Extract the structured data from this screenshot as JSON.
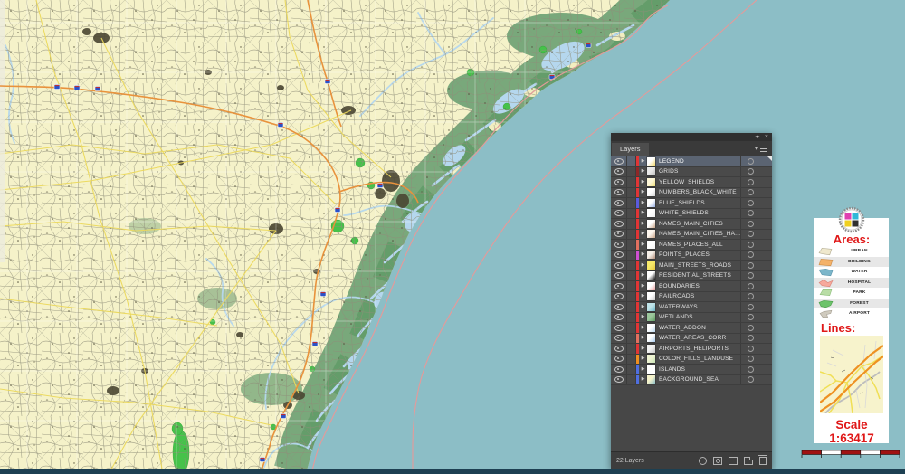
{
  "map": {
    "colors": {
      "sea": "#8cbec6",
      "land": "#f5f2c9",
      "marsh": "#79a87b",
      "water_channels": "#b5d7ee",
      "forest_bright": "#46c24a",
      "urban": "#4a4632",
      "road_network": "#8e8d78",
      "yellow_road": "#ecd95c",
      "orange_highway": "#e8923c",
      "boundary_line": "#e59a9a",
      "interstate_shield": "#2a52c8",
      "bottom_bar": "#1d4052"
    }
  },
  "layers_panel": {
    "title": "Layers",
    "footer_count": "22 Layers",
    "selected_layer": "LEGEND",
    "items": [
      {
        "name": "LEGEND",
        "bar": "#e03535",
        "thumb": [
          "#ffffff",
          "#f3d96d"
        ]
      },
      {
        "name": "GRIDS",
        "bar": "#8f2727",
        "thumb": [
          "#e9e9e9",
          "#bfbfbf"
        ]
      },
      {
        "name": "YELLOW_SHIELDS",
        "bar": "#e03535",
        "thumb": [
          "#fdf7d8",
          "#f0e07a"
        ]
      },
      {
        "name": "NUMBERS_BLACK_WHITE",
        "bar": "#e03535",
        "thumb": [
          "#ffffff",
          "#d8d8d8"
        ]
      },
      {
        "name": "BLUE_SHIELDS",
        "bar": "#5b5bdc",
        "thumb": [
          "#ffffff",
          "#9db4e8"
        ]
      },
      {
        "name": "WHITE_SHIELDS",
        "bar": "#e03535",
        "thumb": [
          "#ffffff",
          "#efefef"
        ]
      },
      {
        "name": "NAMES_MAIN_CITIES",
        "bar": "#e03535",
        "thumb": [
          "#ffffff",
          "#caa68a"
        ]
      },
      {
        "name": "NAMES_MAIN_CITIES_HA...",
        "bar": "#e03535",
        "thumb": [
          "#fdf6ee",
          "#caa68a"
        ]
      },
      {
        "name": "NAMES_PLACES_ALL",
        "bar": "#e2705f",
        "thumb": [
          "#ffffff",
          "#f5f5f5"
        ]
      },
      {
        "name": "POINTS_PLACES",
        "bar": "#cf4fd0",
        "thumb": [
          "#f5efe8",
          "#b5907c"
        ]
      },
      {
        "name": "MAIN_STREETS_ROADS",
        "bar": "#e03535",
        "thumb": [
          "#f7e96a",
          "#e8c93f"
        ]
      },
      {
        "name": "RESIDENTIAL_STREETS",
        "bar": "#e03535",
        "thumb": [
          "#ffffff",
          "#1a1a1a"
        ]
      },
      {
        "name": "BOUNDARIES",
        "bar": "#e03535",
        "thumb": [
          "#ffffff",
          "#e8a0a0"
        ]
      },
      {
        "name": "RAILROADS",
        "bar": "#e03535",
        "thumb": [
          "#ffffff",
          "#c9c9c9"
        ]
      },
      {
        "name": "WATERWAYS",
        "bar": "#e03535",
        "thumb": [
          "#bfe3e8",
          "#6fb8c9"
        ]
      },
      {
        "name": "WETLANDS",
        "bar": "#e03535",
        "thumb": [
          "#9cc79c",
          "#5f9e63"
        ]
      },
      {
        "name": "WATER_ADDON",
        "bar": "#e03535",
        "thumb": [
          "#ffffff",
          "#bcd9f0"
        ]
      },
      {
        "name": "WATER_AREAS_CORR",
        "bar": "#e2705f",
        "thumb": [
          "#ffffff",
          "#a9cdf0"
        ]
      },
      {
        "name": "AIRPORTS_HELIPORTS",
        "bar": "#e03535",
        "thumb": [
          "#f2f2f2",
          "#c7c7c7"
        ]
      },
      {
        "name": "COLOR_FILLS_LANDUSE",
        "bar": "#ef8f1f",
        "thumb": [
          "#eef3d2",
          "#c9e4b4"
        ]
      },
      {
        "name": "ISLANDS",
        "bar": "#4f6fe0",
        "thumb": [
          "#ffffff",
          "#ffffff"
        ]
      },
      {
        "name": "BACKGROUND_SEA",
        "bar": "#4f6fe0",
        "thumb": [
          "#f5f2ca",
          "#8fc0c8"
        ]
      }
    ]
  },
  "legend": {
    "areas_title": "Areas:",
    "lines_title": "Lines:",
    "scale_text": "Scale 1:63417",
    "accent_red": "#e01818",
    "areas": [
      {
        "label": "URBAN",
        "fill": "#efe8cd",
        "stroke": "#b7b096"
      },
      {
        "label": "BUILDING",
        "fill": "#f4b26a",
        "stroke": "#cd8f4a"
      },
      {
        "label": "WATER",
        "fill": "#7cb6ca",
        "stroke": "#5e98ae"
      },
      {
        "label": "HOSPITAL",
        "fill": "#f6a89b",
        "stroke": "#d98579"
      },
      {
        "label": "PARK",
        "fill": "#b9dda6",
        "stroke": "#8fbf7d"
      },
      {
        "label": "FOREST",
        "fill": "#6dc36b",
        "stroke": "#4da04c"
      },
      {
        "label": "AIRPORT",
        "fill": "#cfcabe",
        "stroke": "#a8a295"
      }
    ]
  }
}
